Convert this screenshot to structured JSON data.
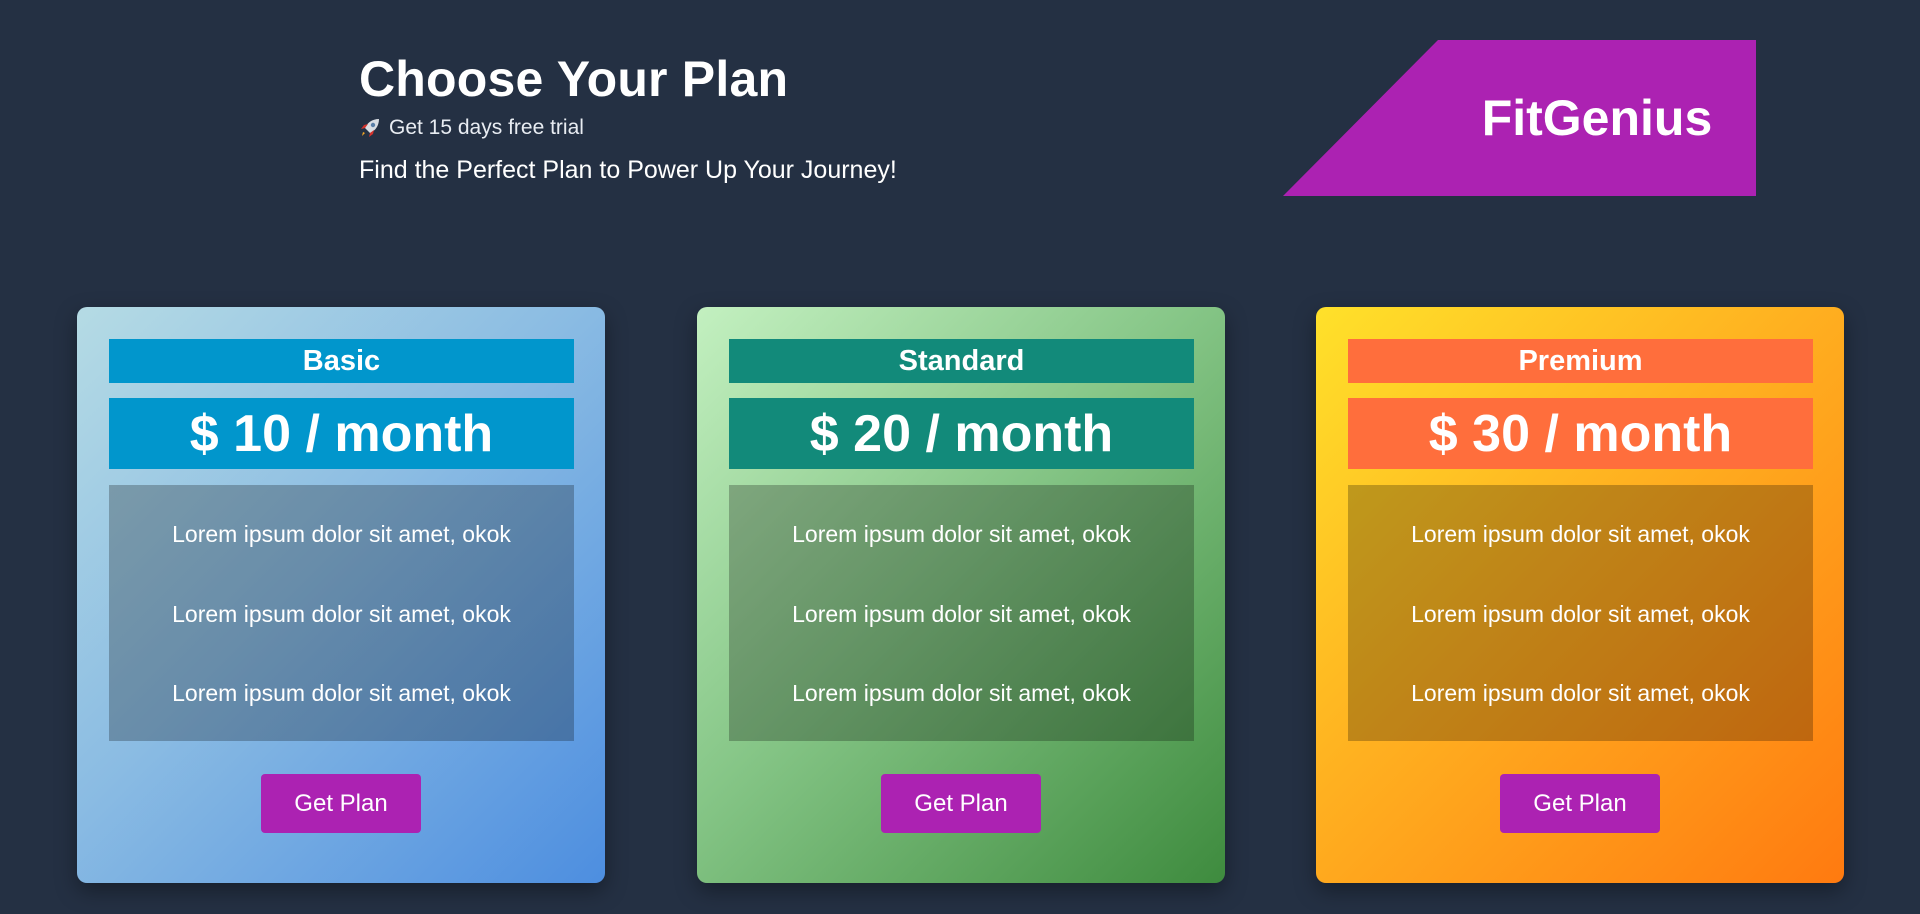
{
  "header": {
    "title": "Choose Your Plan",
    "trial_text": "Get 15 days free trial",
    "tagline": "Find the Perfect Plan to Power Up Your Journey!"
  },
  "brand": {
    "name": "FitGenius",
    "color": "#ac22b2"
  },
  "plans": [
    {
      "name": "Basic",
      "price": "$ 10 / month",
      "accent": "#0196cc",
      "features": [
        "Lorem ipsum dolor sit amet, okok",
        "Lorem ipsum dolor sit amet, okok",
        "Lorem ipsum dolor sit amet, okok"
      ],
      "button_label": "Get Plan"
    },
    {
      "name": "Standard",
      "price": "$ 20 / month",
      "accent": "#128a7a",
      "features": [
        "Lorem ipsum dolor sit amet, okok",
        "Lorem ipsum dolor sit amet, okok",
        "Lorem ipsum dolor sit amet, okok"
      ],
      "button_label": "Get Plan"
    },
    {
      "name": "Premium",
      "price": "$ 30 / month",
      "accent": "#ff6e3c",
      "features": [
        "Lorem ipsum dolor sit amet, okok",
        "Lorem ipsum dolor sit amet, okok",
        "Lorem ipsum dolor sit amet, okok"
      ],
      "button_label": "Get Plan"
    }
  ],
  "colors": {
    "background": "#243043",
    "button": "#ac22b2"
  }
}
